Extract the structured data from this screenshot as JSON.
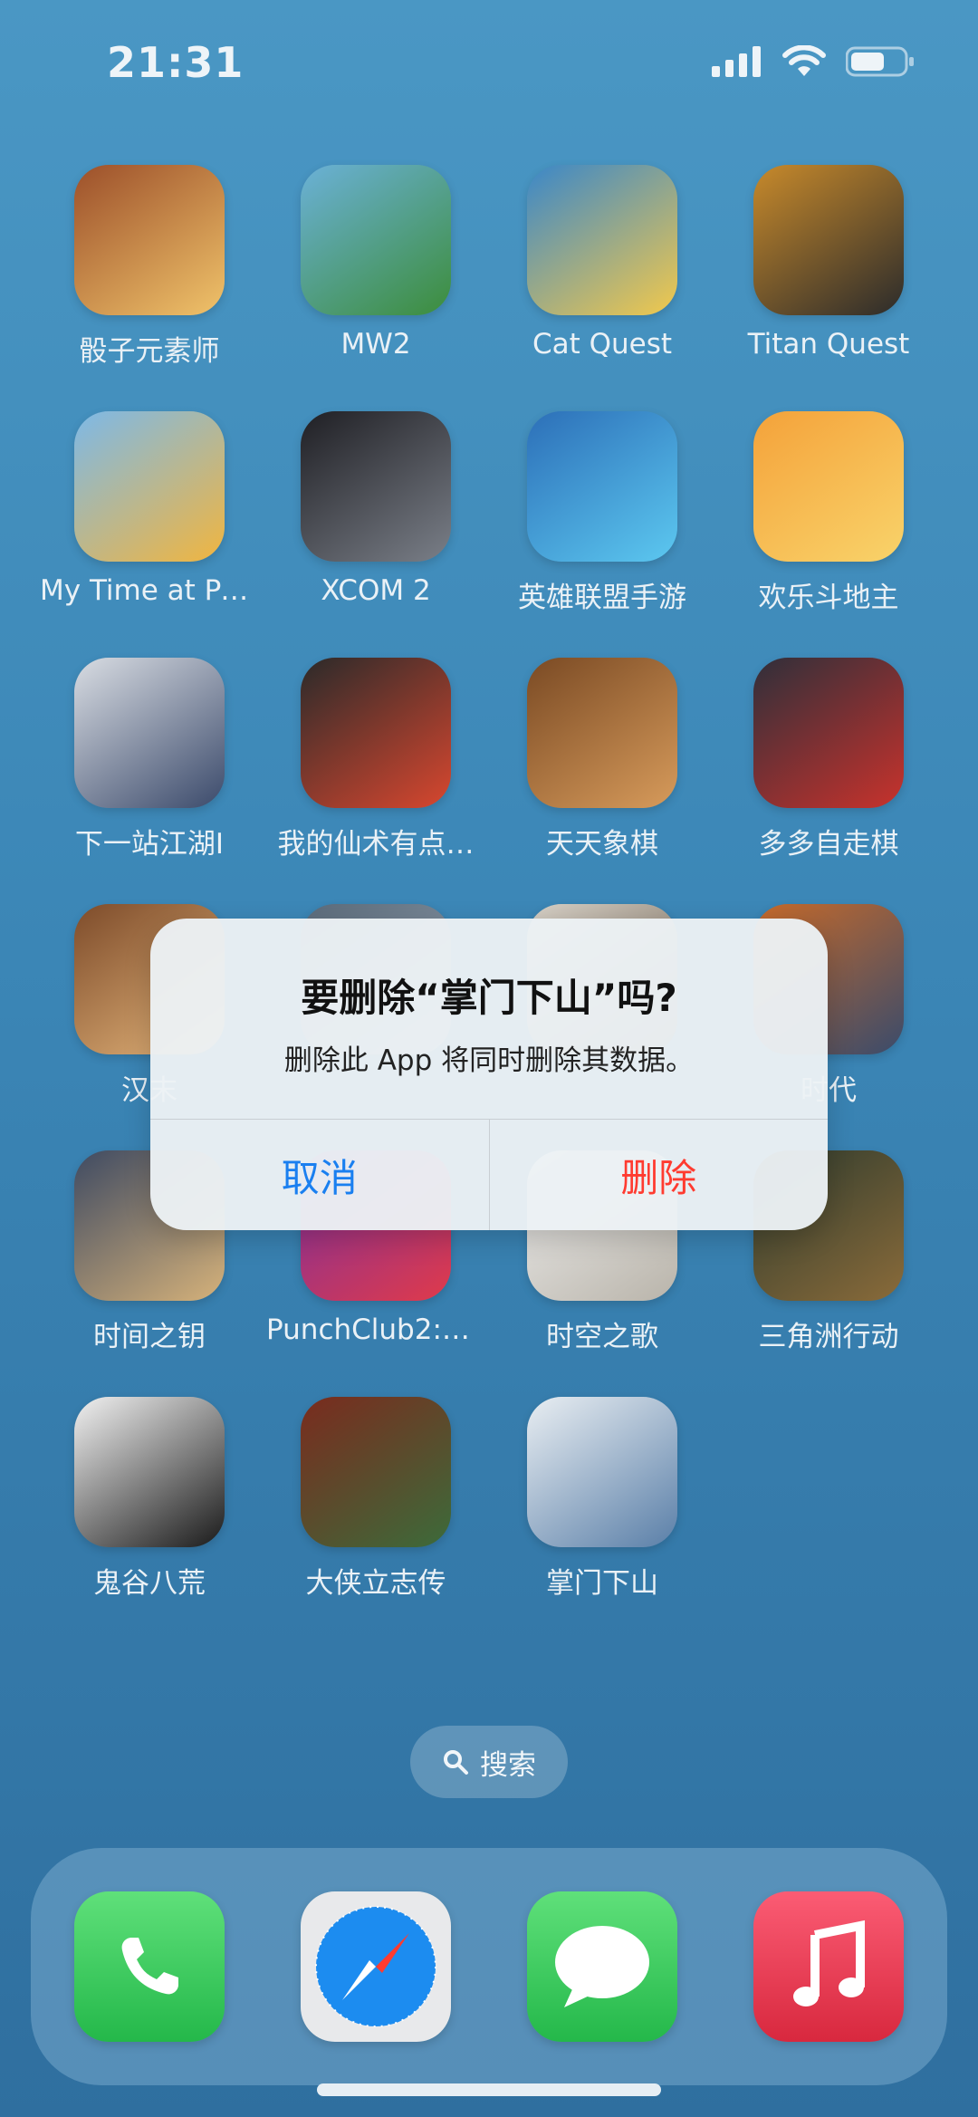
{
  "status_bar": {
    "time": "21:31"
  },
  "apps": [
    {
      "name": "骰子元素师",
      "icon": "dice-elementalist-icon",
      "colors": [
        "#9c4f2a",
        "#f0c36a"
      ]
    },
    {
      "name": "MW2",
      "icon": "mw2-icon",
      "colors": [
        "#6bb1d8",
        "#3c8d3b"
      ]
    },
    {
      "name": "Cat Quest",
      "icon": "cat-quest-icon",
      "colors": [
        "#3a87c9",
        "#f2c94c"
      ]
    },
    {
      "name": "Titan Quest",
      "icon": "titan-quest-icon",
      "colors": [
        "#c88a2b",
        "#2b2b2b"
      ]
    },
    {
      "name": "My Time at Portia",
      "icon": "portia-icon",
      "colors": [
        "#7db9e8",
        "#f1b53f"
      ]
    },
    {
      "name": "XCOM 2",
      "icon": "xcom2-icon",
      "colors": [
        "#1f1f24",
        "#7a7f88"
      ]
    },
    {
      "name": "英雄联盟手游",
      "icon": "lol-wild-rift-icon",
      "colors": [
        "#2c6fb8",
        "#5cc8f0"
      ]
    },
    {
      "name": "欢乐斗地主",
      "icon": "dou-di-zhu-icon",
      "colors": [
        "#f4a23a",
        "#f9d36a"
      ]
    },
    {
      "name": "下一站江湖Ⅰ",
      "icon": "jianghu-icon",
      "colors": [
        "#d9dde3",
        "#3b4a6b"
      ]
    },
    {
      "name": "我的仙术有点…",
      "icon": "xianshu-icon",
      "colors": [
        "#2a2a2a",
        "#d8472f"
      ]
    },
    {
      "name": "天天象棋",
      "icon": "xiangqi-icon",
      "colors": [
        "#7a4a24",
        "#d79b5b"
      ]
    },
    {
      "name": "多多自走棋",
      "icon": "auto-chess-icon",
      "colors": [
        "#2f2f3a",
        "#c8322c"
      ]
    },
    {
      "name": "汉末",
      "icon": "hanmo-icon",
      "colors": [
        "#7d4b2a",
        "#e6b77c"
      ]
    },
    {
      "name": "",
      "icon": "hidden-app-1-icon",
      "colors": [
        "#5a6a7a",
        "#9aa7b5"
      ]
    },
    {
      "name": "",
      "icon": "hidden-app-2-icon",
      "colors": [
        "#d8d2c8",
        "#6a5a4a"
      ]
    },
    {
      "name": "时代",
      "icon": "shidai-icon",
      "colors": [
        "#c76a2a",
        "#3a4b6b"
      ]
    },
    {
      "name": "时间之钥",
      "icon": "time-key-icon",
      "colors": [
        "#3e4a62",
        "#d6b27a"
      ]
    },
    {
      "name": "PunchClub2:F…",
      "icon": "punch-club-2-icon",
      "colors": [
        "#7a2fa0",
        "#e03a4a"
      ]
    },
    {
      "name": "时空之歌",
      "icon": "shikong-icon",
      "colors": [
        "#efefef",
        "#b9b4aa"
      ]
    },
    {
      "name": "三角洲行动",
      "icon": "delta-force-icon",
      "colors": [
        "#2d3a2d",
        "#8a6b3a"
      ]
    },
    {
      "name": "鬼谷八荒",
      "icon": "guigu-icon",
      "colors": [
        "#f2f2f2",
        "#1a1a1a"
      ]
    },
    {
      "name": "大侠立志传",
      "icon": "daxia-icon",
      "colors": [
        "#7a2b1e",
        "#3c6b3a"
      ]
    },
    {
      "name": "掌门下山",
      "icon": "zhangmen-icon",
      "colors": [
        "#e9eef2",
        "#5a7fa8"
      ]
    }
  ],
  "search": {
    "label": "搜索"
  },
  "dock": [
    {
      "icon": "phone-icon",
      "color": "#34c759"
    },
    {
      "icon": "safari-icon",
      "color": "#1c8cf0"
    },
    {
      "icon": "messages-icon",
      "color": "#34c759"
    },
    {
      "icon": "music-icon",
      "color": "#fa3c4f"
    }
  ],
  "alert": {
    "title": "要删除“掌门下山”吗?",
    "message": "删除此 App 将同时删除其数据。",
    "cancel": "取消",
    "delete": "删除",
    "cancel_color": "#1a7ff0",
    "delete_color": "#ff3b30"
  }
}
